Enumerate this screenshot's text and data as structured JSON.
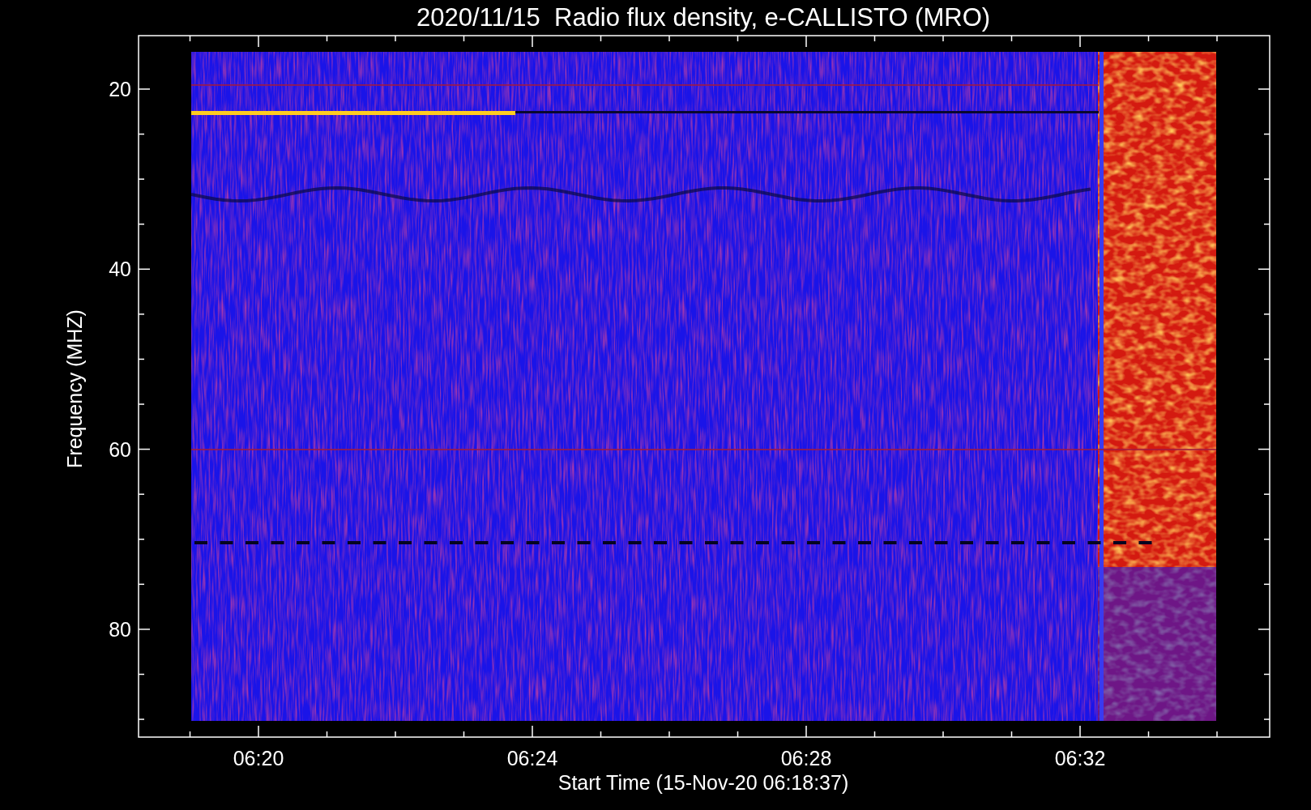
{
  "plot": {
    "title": "2020/11/15  Radio flux density, e-CALLISTO (MRO)",
    "ylabel": "Frequency (MHZ)",
    "xlabel": "Start Time (15-Nov-20 06:18:37)",
    "yticks": [
      "20",
      "40",
      "60",
      "80"
    ],
    "xticks": [
      "06:20",
      "06:24",
      "06:28",
      "06:32"
    ]
  }
}
